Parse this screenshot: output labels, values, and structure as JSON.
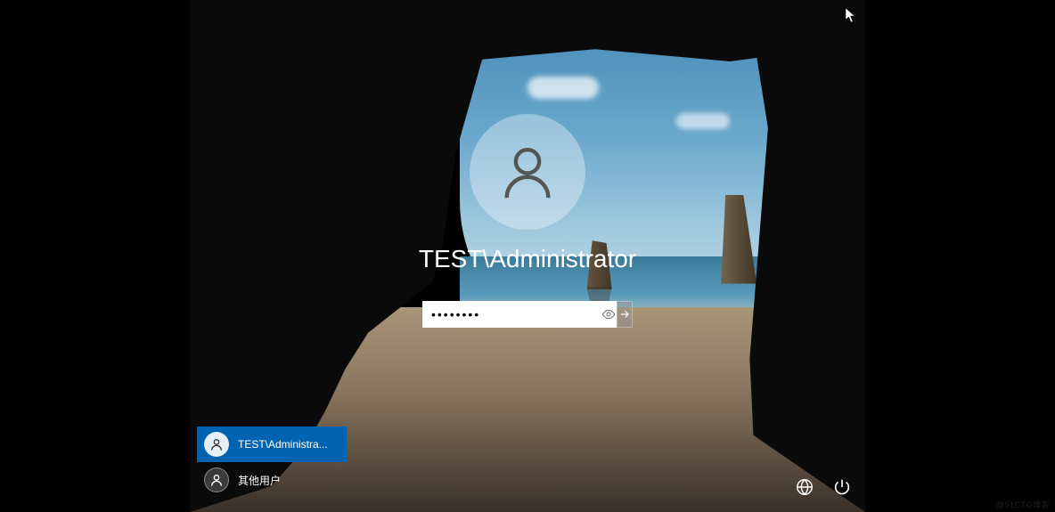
{
  "login": {
    "username": "TEST\\Administrator",
    "password_value": "••••••••",
    "password_placeholder": ""
  },
  "user_list": {
    "items": [
      {
        "label": "TEST\\Administra...",
        "selected": true
      },
      {
        "label": "其他用户",
        "selected": false
      }
    ]
  },
  "icons": {
    "network": "network-icon",
    "power": "power-icon"
  },
  "watermark": "@51CTO博客"
}
